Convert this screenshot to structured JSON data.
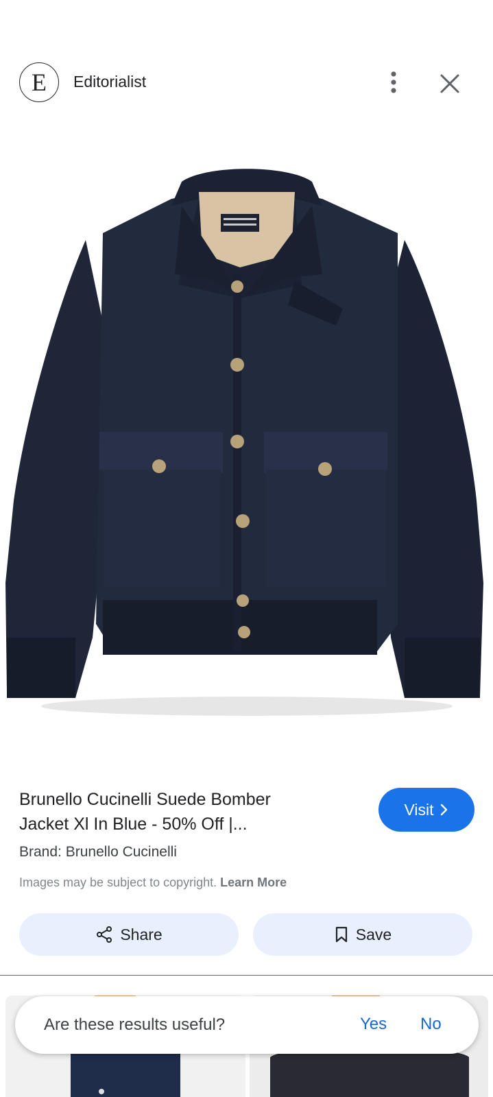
{
  "header": {
    "avatar_letter": "E",
    "source_name": "Editorialist"
  },
  "product": {
    "title_line1": "Brunello Cucinelli Suede Bomber",
    "title_line2": "Jacket Xl In Blue - 50% Off |...",
    "brand": "Brand: Brunello Cucinelli",
    "copyright_text": "Images may be subject to copyright.",
    "learn_more": "Learn More"
  },
  "actions": {
    "visit": "Visit",
    "share": "Share",
    "save": "Save"
  },
  "feedback": {
    "question": "Are these results useful?",
    "yes": "Yes",
    "no": "No"
  },
  "colors": {
    "accent": "#1a73e8",
    "chip_bg": "#e8f0fe",
    "jacket": "#1f2638"
  }
}
